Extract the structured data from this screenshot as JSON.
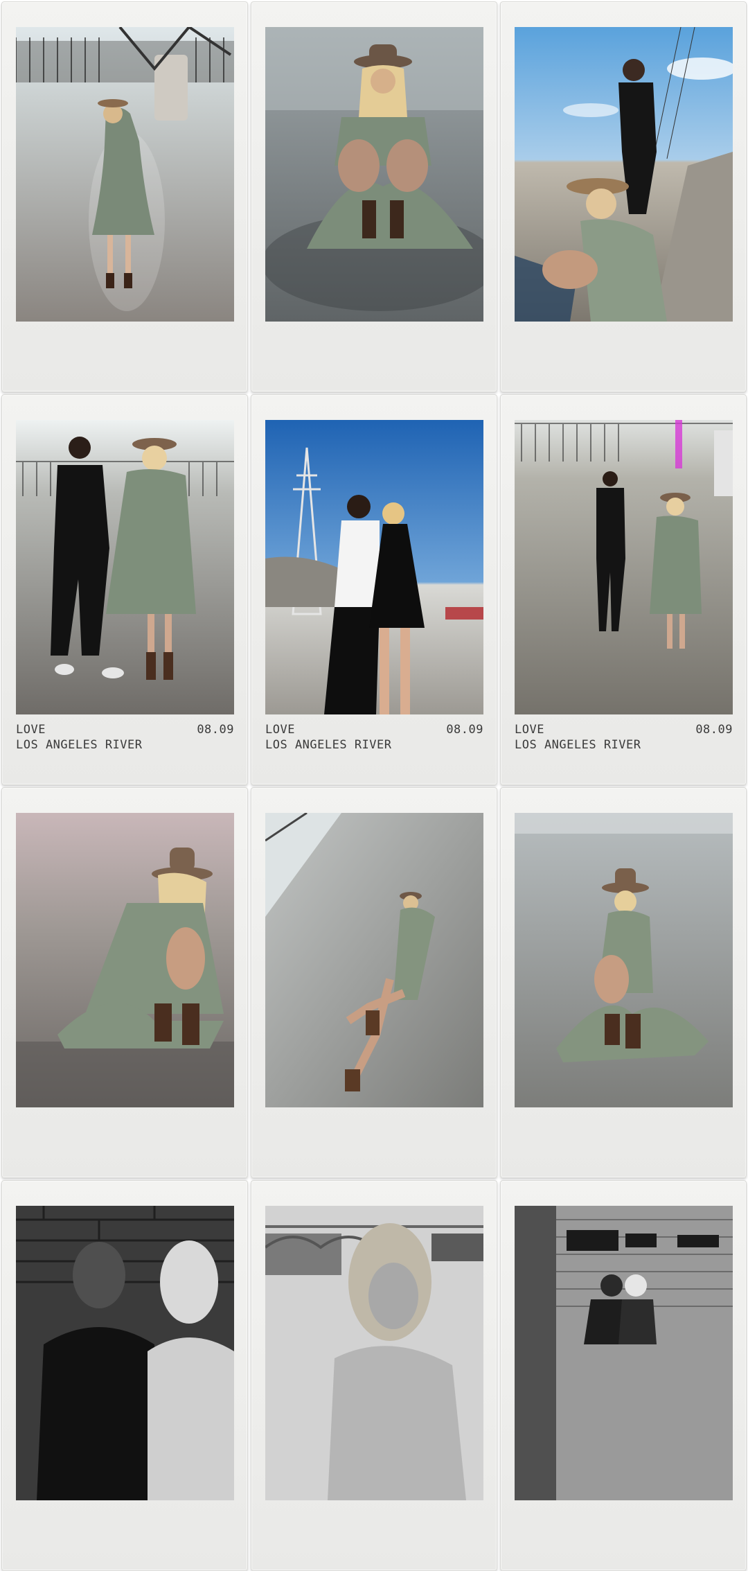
{
  "cards": [
    {
      "caption": null,
      "photo_alt": "Woman in floral wrap dress and hat standing on concrete riverbed"
    },
    {
      "caption": null,
      "photo_alt": "Woman in hat squatting on concrete"
    },
    {
      "caption": null,
      "photo_alt": "Woman crouching holding hat with man standing behind under blue sky"
    },
    {
      "caption": {
        "title": "LOVE",
        "date": "08.09",
        "location": "LOS ANGELES RIVER"
      },
      "photo_alt": "Couple standing side by side on concrete"
    },
    {
      "caption": {
        "title": "LOVE",
        "date": "08.09",
        "location": "LOS ANGELES RIVER"
      },
      "photo_alt": "Couple near power tower and bridge under blue sky"
    },
    {
      "caption": {
        "title": "LOVE",
        "date": "08.09",
        "location": "LOS ANGELES RIVER"
      },
      "photo_alt": "Couple standing apart on concrete with fence behind"
    },
    {
      "caption": null,
      "photo_alt": "Woman sitting on concrete holding hat"
    },
    {
      "caption": null,
      "photo_alt": "Woman reclining on sloped concrete"
    },
    {
      "caption": null,
      "photo_alt": "Woman sitting on sloped concrete wearing hat"
    },
    {
      "caption": null,
      "photo_alt": "Black and white couple against brick wall"
    },
    {
      "caption": null,
      "photo_alt": "Black and white woman portrait near bridge"
    },
    {
      "caption": null,
      "photo_alt": "Black and white couple in front of brick building"
    }
  ]
}
